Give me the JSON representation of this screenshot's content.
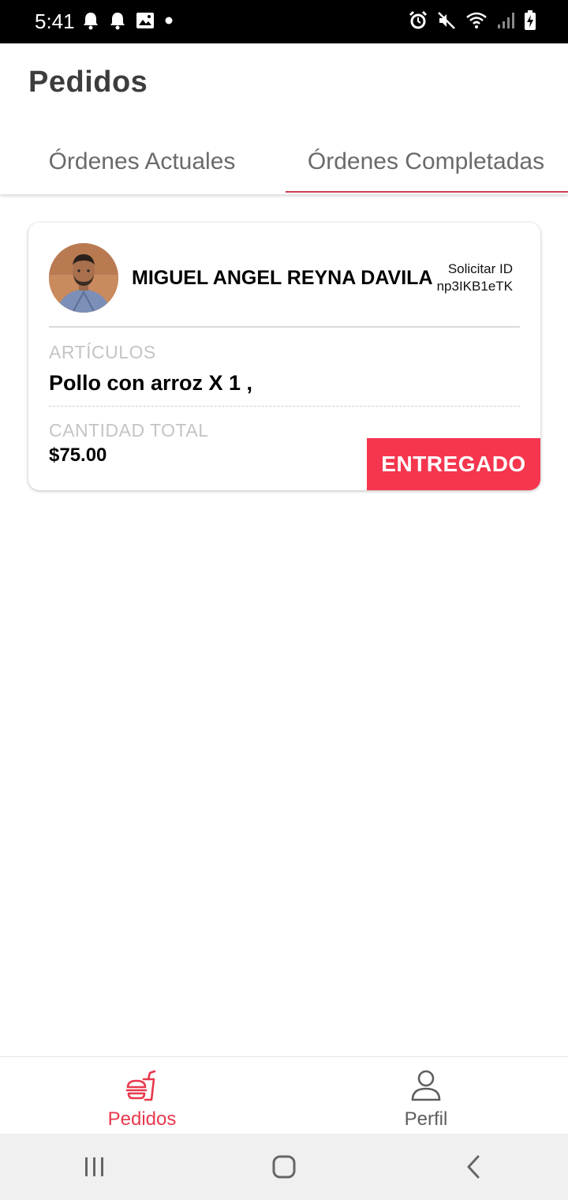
{
  "status_bar": {
    "time": "5:41",
    "left_icons": [
      "bell-icon",
      "bell-icon",
      "image-icon",
      "dot-icon"
    ],
    "right_icons": [
      "alarm-icon",
      "mute-icon",
      "wifi-icon",
      "signal-icon",
      "battery-charging-icon"
    ]
  },
  "header": {
    "title": "Pedidos"
  },
  "tabs": [
    {
      "label": "Órdenes Actuales",
      "active": false
    },
    {
      "label": "Órdenes Completadas",
      "active": true
    }
  ],
  "orders": [
    {
      "customer_name": "MIGUEL ANGEL REYNA DAVILA",
      "order_id_label": "Solicitar ID",
      "order_id": "np3IKB1eTK",
      "items_label": "ARTÍCULOS",
      "items": "Pollo con arroz X 1 ,",
      "total_label": "CANTIDAD TOTAL",
      "total": "$75.00",
      "status": "ENTREGADO"
    }
  ],
  "bottom_nav": [
    {
      "label": "Pedidos",
      "icon": "food-icon",
      "active": true
    },
    {
      "label": "Perfil",
      "icon": "user-icon",
      "active": false
    }
  ],
  "system_nav": [
    "recents-icon",
    "home-icon",
    "back-icon"
  ],
  "colors": {
    "accent": "#e8394d",
    "badge": "#f5364e",
    "tab_indicator": "#c8434f",
    "muted_label": "#c4c4c4"
  }
}
